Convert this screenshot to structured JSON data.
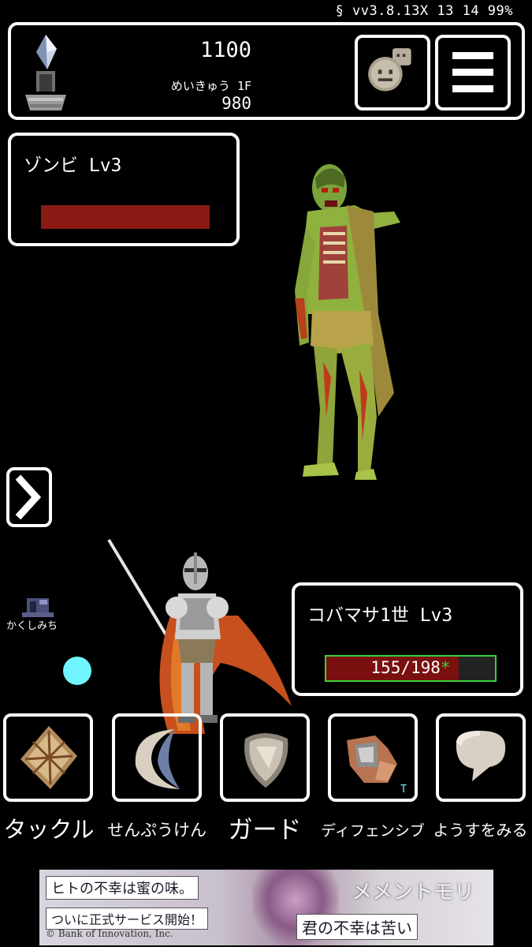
{
  "status_bar": {
    "text": "§ vv3.8.13X 13 14 99%"
  },
  "header": {
    "gem_count": "1100",
    "floor_label": "めいきゅう 1F",
    "floor_value": "980",
    "chat_icon": "chat-face-icon",
    "menu_icon": "hamburger-menu-icon"
  },
  "enemy": {
    "name": "ゾンビ Lv3",
    "hp_fraction": 1.0,
    "hp_color": "#8a1a14"
  },
  "player": {
    "name": "コバマサ1世 Lv3",
    "hp_current": 155,
    "hp_max": 198,
    "hp_text": "155/198",
    "hp_marker": "*",
    "hp_fill_color": "#7a1010",
    "hp_border_color": "#3ad13a"
  },
  "field": {
    "hidden_path_label": "かくしみち",
    "dot_color": "#6ff5ff"
  },
  "skills": [
    {
      "label": "タックル",
      "icon": "tackle-icon"
    },
    {
      "label": "せんぷうけん",
      "icon": "whirlwind-sword-icon"
    },
    {
      "label": "ガード",
      "icon": "shield-icon"
    },
    {
      "label": "ディフェンシブ",
      "icon": "defensive-icon",
      "tag": "T"
    },
    {
      "label": "ようすをみる",
      "icon": "speech-bubble-icon"
    }
  ],
  "ad": {
    "line1": "ヒトの不幸は蜜の味。",
    "line2": "ついに正式サービス開始！",
    "line3": "© Bank of Innovation, Inc.",
    "title": "メメントモリ",
    "slogan": "君の不幸は苦い"
  }
}
